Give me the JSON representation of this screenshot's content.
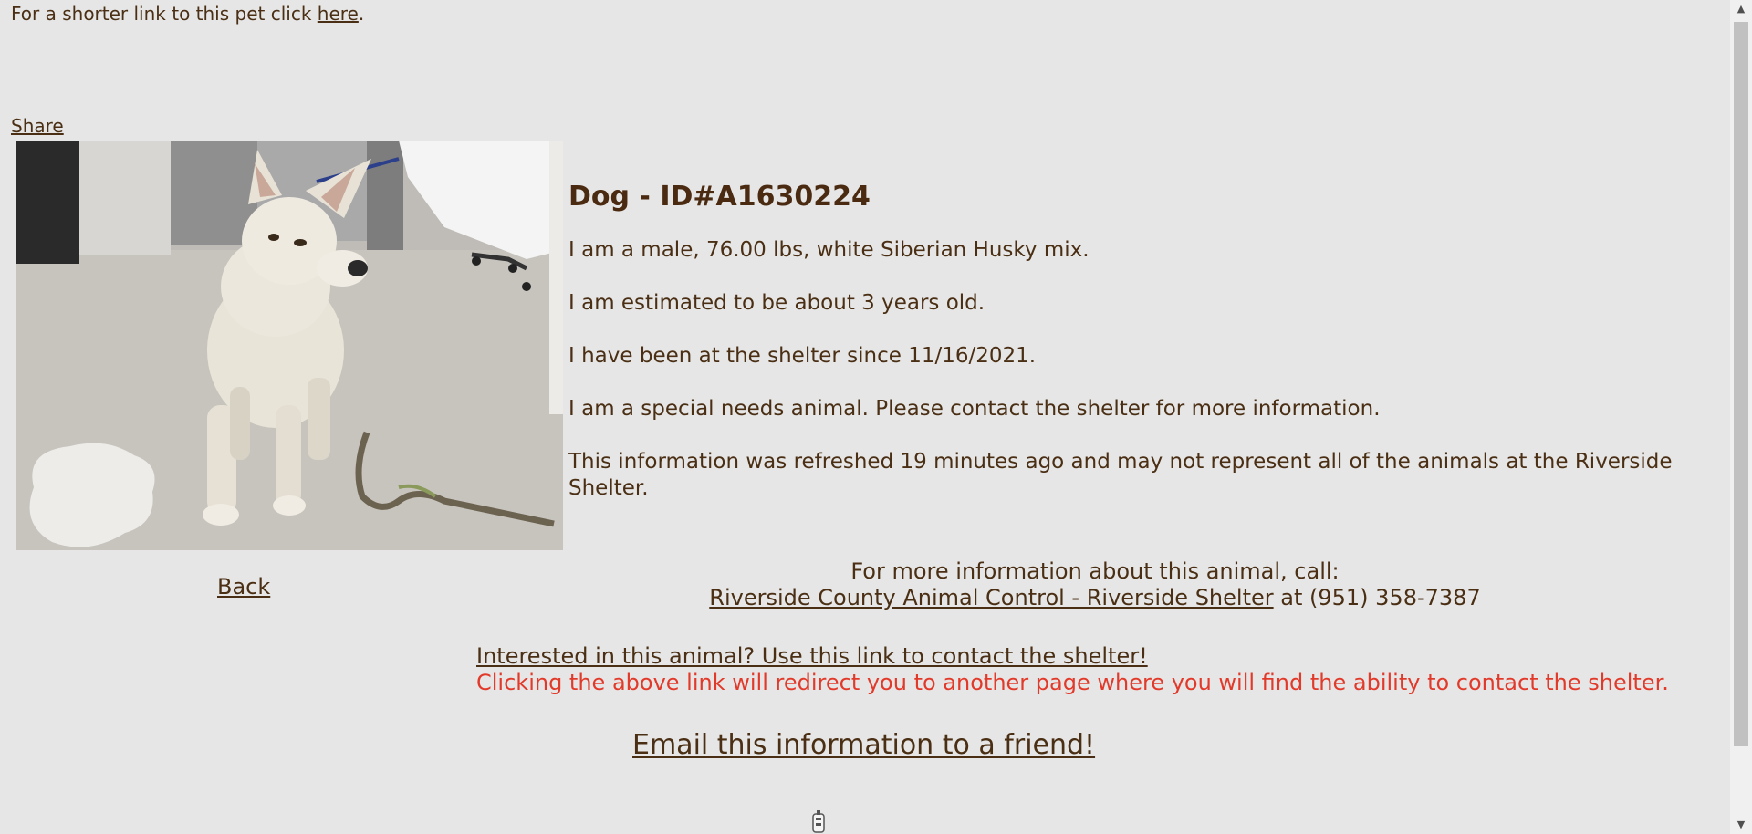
{
  "header": {
    "short_link_prefix": "For a shorter link to this pet click ",
    "short_link_label": "here",
    "short_link_suffix": ".",
    "share_label": "Share"
  },
  "animal": {
    "title": "Dog - ID#A1630224",
    "description": "I am a male, 76.00 lbs, white Siberian Husky mix.",
    "age": "I am estimated to be about 3 years old.",
    "since": "I have been at the shelter since 11/16/2021.",
    "special_needs": "I am a special needs animal. Please contact the shelter for more information.",
    "refreshed": "This information was refreshed 19 minutes ago and may not represent all of the animals at the Riverside Shelter."
  },
  "nav": {
    "back_label": "Back"
  },
  "contact": {
    "intro": "For more information about this animal, call:",
    "shelter_name": "Riverside County Animal Control - Riverside Shelter",
    "phone_text": " at (951) 358-7387"
  },
  "interest": {
    "link_label": "Interested in this animal? Use this link to contact the shelter!",
    "note": "Clicking the above link will redirect you to another page where you will find the ability to contact the shelter."
  },
  "email": {
    "label": "Email this information to a friend!"
  },
  "colors": {
    "background": "#e6e6e6",
    "text": "#4a2f14",
    "warning": "#e23a2a"
  }
}
